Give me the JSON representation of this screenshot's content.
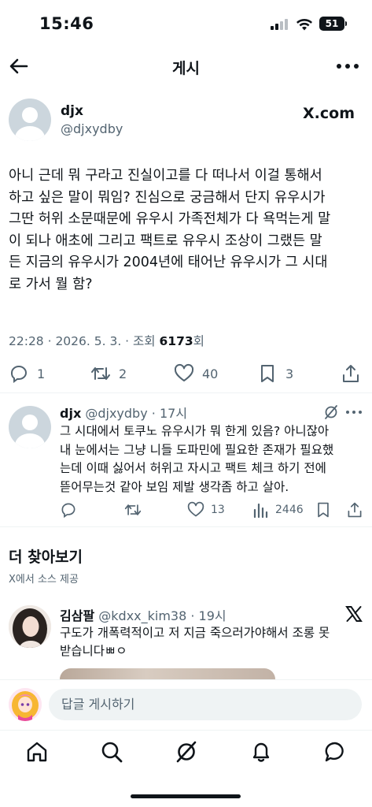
{
  "status_bar": {
    "time": "15:46",
    "battery": "51"
  },
  "header": {
    "title": "게시"
  },
  "post": {
    "author_name": "djx",
    "author_handle": "@djxydby",
    "source_label": "X.com",
    "text_lines": [
      "아니 근데 뭐 구라고 진실이고를 다 떠나서 이걸 통해서",
      "하고 싶은 말이 뭐임? 진심으로 궁금해서 단지 유우시가",
      "그딴 허위 소문때문에 유우시 가족전체가 다 욕먹는게 말",
      "이 되나 애초에 그리고 팩트로 유우시 조상이 그랬든 말",
      "든 지금의 유우시가 2004년에 태어난 유우시가 그 시대",
      "로 가서 뭘 함?"
    ],
    "timestamp": "22:28 · 2026. 5. 3. · 조회",
    "views": "6173",
    "views_suffix": "회",
    "stats": {
      "replies": "1",
      "reposts": "2",
      "likes": "40",
      "bookmarks": "3"
    }
  },
  "reply": {
    "author_name": "djx",
    "author_handle": "@djxydby",
    "time": "· 17시",
    "text_lines": [
      "그 시대에서 토쿠노 유우시가 뭐 한게 있음? 아니잖아",
      "내 눈에서는 그냥 니들 도파민에 필요한 존재가 필요했",
      "는데 이때 싫어서 허위고 자시고 팩트 체크 하기 전에",
      "뜯어무는것 같아 보임 제발 생각좀 하고 살아."
    ],
    "stats": {
      "likes": "13",
      "views": "2446"
    }
  },
  "discover": {
    "title": "더 찾아보기",
    "subtitle": "X에서 소스 제공",
    "item": {
      "author_name": "김삼팔",
      "author_handle": "@kdxx_kim38",
      "time": "· 19시",
      "text_lines": [
        "구도가 개폭력적이고 저 지금 죽으러가야해서 조롱 못",
        "받습니다ㅃㅇ"
      ]
    }
  },
  "compose": {
    "placeholder": "답글 게시하기"
  },
  "tabs": [
    "home-icon",
    "search-icon",
    "grok-icon",
    "notifications-icon",
    "messages-icon"
  ],
  "colors": {
    "text": "#0f1419",
    "secondary": "#536471",
    "divider": "#eff3f4",
    "field": "#eff3f4"
  }
}
